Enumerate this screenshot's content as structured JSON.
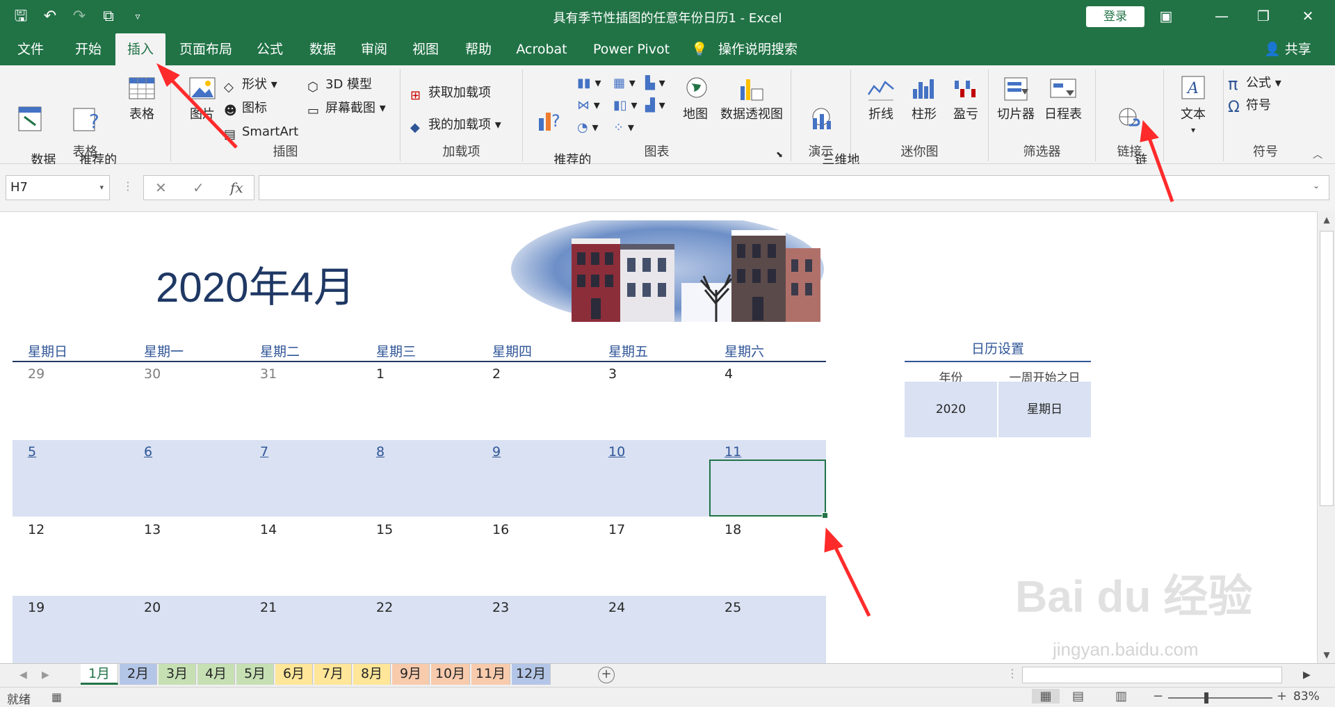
{
  "window": {
    "title": "具有季节性插图的任意年份日历1  -  Excel",
    "login": "登录",
    "qat_icons": [
      "save-icon",
      "undo-icon",
      "redo-icon",
      "touch-mode-icon",
      "customize-qat-icon"
    ]
  },
  "tabs": [
    {
      "label": "文件"
    },
    {
      "label": "开始"
    },
    {
      "label": "插入"
    },
    {
      "label": "页面布局"
    },
    {
      "label": "公式"
    },
    {
      "label": "数据"
    },
    {
      "label": "审阅"
    },
    {
      "label": "视图"
    },
    {
      "label": "帮助"
    },
    {
      "label": "Acrobat"
    },
    {
      "label": "Power Pivot"
    },
    {
      "label": "操作说明搜索"
    }
  ],
  "share": "共享",
  "ribbon": {
    "groups": {
      "tables": "表格",
      "illustrations": "插图",
      "addins": "加载项",
      "charts": "图表",
      "tours": "演示",
      "sparklines": "迷你图",
      "filters": "筛选器",
      "links": "链接",
      "symbols": "符号"
    },
    "buttons": {
      "pivot_table": "数据\n透视表",
      "recommended_pivot": "推荐的\n数据透视表",
      "table": "表格",
      "pictures": "图片",
      "shapes": "形状",
      "icons": "图标",
      "smartart": "SmartArt",
      "model3d": "3D 模型",
      "screenshot": "屏幕截图",
      "get_addins": "获取加载项",
      "my_addins": "我的加载项",
      "recommended_charts": "推荐的\n图表",
      "maps": "地图",
      "pivot_chart": "数据透视图",
      "map3d": "三维地\n图",
      "line": "折线",
      "column": "柱形",
      "win_loss": "盈亏",
      "slicer": "切片器",
      "timeline": "日程表",
      "link": "链\n接",
      "text": "文本",
      "equation": "公式",
      "symbol": "符号"
    }
  },
  "formula_bar": {
    "name_box": "H7",
    "fx": "fx",
    "cancel": "✕",
    "enter": "✓",
    "value": ""
  },
  "calendar": {
    "title": "2020年4月",
    "day_names": [
      "星期日",
      "星期一",
      "星期二",
      "星期三",
      "星期四",
      "星期五",
      "星期六"
    ],
    "weeks": [
      {
        "shade": false,
        "days": [
          {
            "n": "29",
            "style": "muted"
          },
          {
            "n": "30",
            "style": "muted"
          },
          {
            "n": "31",
            "style": "muted"
          },
          {
            "n": "1",
            "style": ""
          },
          {
            "n": "2",
            "style": ""
          },
          {
            "n": "3",
            "style": ""
          },
          {
            "n": "4",
            "style": ""
          }
        ]
      },
      {
        "shade": true,
        "days": [
          {
            "n": "5",
            "style": "link"
          },
          {
            "n": "6",
            "style": "link"
          },
          {
            "n": "7",
            "style": "link"
          },
          {
            "n": "8",
            "style": "link"
          },
          {
            "n": "9",
            "style": "link"
          },
          {
            "n": "10",
            "style": "link"
          },
          {
            "n": "11",
            "style": "link"
          }
        ]
      },
      {
        "shade": false,
        "days": [
          {
            "n": "12",
            "style": ""
          },
          {
            "n": "13",
            "style": ""
          },
          {
            "n": "14",
            "style": ""
          },
          {
            "n": "15",
            "style": ""
          },
          {
            "n": "16",
            "style": ""
          },
          {
            "n": "17",
            "style": ""
          },
          {
            "n": "18",
            "style": ""
          }
        ]
      },
      {
        "shade": true,
        "days": [
          {
            "n": "19",
            "style": ""
          },
          {
            "n": "20",
            "style": ""
          },
          {
            "n": "21",
            "style": ""
          },
          {
            "n": "22",
            "style": ""
          },
          {
            "n": "23",
            "style": ""
          },
          {
            "n": "24",
            "style": ""
          },
          {
            "n": "25",
            "style": ""
          }
        ]
      }
    ]
  },
  "settings": {
    "title": "日历设置",
    "year_label": "年份",
    "weekstart_label": "一周开始之日",
    "year_value": "2020",
    "weekstart_value": "星期日"
  },
  "watermark": {
    "main": "Bai du 经验",
    "sub": "jingyan.baidu.com"
  },
  "sheet_tabs": [
    {
      "label": "1月",
      "color": "#ffffff",
      "active": true
    },
    {
      "label": "2月",
      "color": "#b4c6e7",
      "active": false
    },
    {
      "label": "3月",
      "color": "#c6e0b4",
      "active": false
    },
    {
      "label": "4月",
      "color": "#c6e0b4",
      "active": false
    },
    {
      "label": "5月",
      "color": "#c6e0b4",
      "active": false
    },
    {
      "label": "6月",
      "color": "#ffe699",
      "active": false
    },
    {
      "label": "7月",
      "color": "#ffe699",
      "active": false
    },
    {
      "label": "8月",
      "color": "#ffe699",
      "active": false
    },
    {
      "label": "9月",
      "color": "#f8cbad",
      "active": false
    },
    {
      "label": "10月",
      "color": "#f8cbad",
      "active": false
    },
    {
      "label": "11月",
      "color": "#f8cbad",
      "active": false
    },
    {
      "label": "12月",
      "color": "#b4c6e7",
      "active": false
    }
  ],
  "status": {
    "ready": "就绪",
    "zoom": "83%"
  },
  "colors": {
    "excel_green": "#217346",
    "calendar_blue": "#1f3864",
    "shade": "#d9e1f2",
    "annotation_red": "#ff2b2b"
  }
}
